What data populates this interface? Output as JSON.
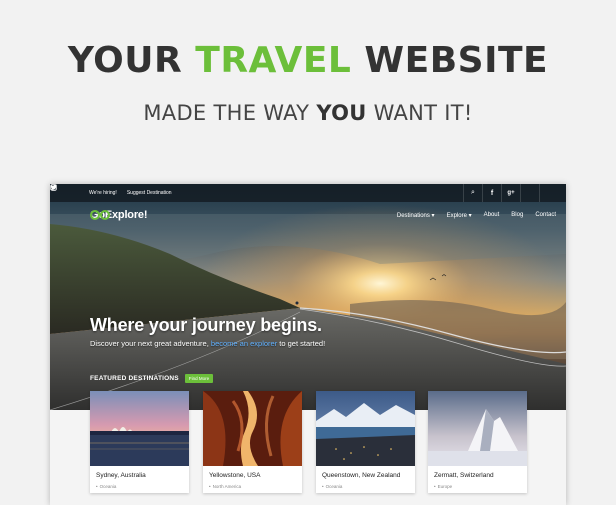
{
  "banner": {
    "headline_part1": "YOUR",
    "headline_accent": "TRAVEL",
    "headline_part2": "WEBSITE",
    "subhead_part1": "MADE THE WAY",
    "subhead_bold": "YOU",
    "subhead_part2": "WANT IT!"
  },
  "topbar": {
    "links": [
      "We're hiring!",
      "Suggest Destination"
    ],
    "icons": [
      "search-icon",
      "facebook-icon",
      "google-plus-icon",
      "twitter-icon",
      "instagram-icon"
    ]
  },
  "site": {
    "logo_text": "GoExplore!",
    "nav": [
      "Destinations ▾",
      "Explore ▾",
      "About",
      "Blog",
      "Contact"
    ]
  },
  "hero": {
    "tagline": "Where your journey begins.",
    "subline_before": "Discover your next great adventure,",
    "subline_link": "become an explorer",
    "subline_after": "to get started!"
  },
  "featured": {
    "heading": "FEATURED DESTINATIONS",
    "button": "Find More",
    "cards": [
      {
        "title": "Sydney, Australia",
        "region": "Oceania"
      },
      {
        "title": "Yellowstone, USA",
        "region": "North America"
      },
      {
        "title": "Queenstown, New Zealand",
        "region": "Oceania"
      },
      {
        "title": "Zermatt, Switzerland",
        "region": "Europe"
      }
    ]
  },
  "colors": {
    "accent": "#6cbf3a",
    "text_dark": "#333333",
    "link_blue": "#5fb0ff"
  }
}
